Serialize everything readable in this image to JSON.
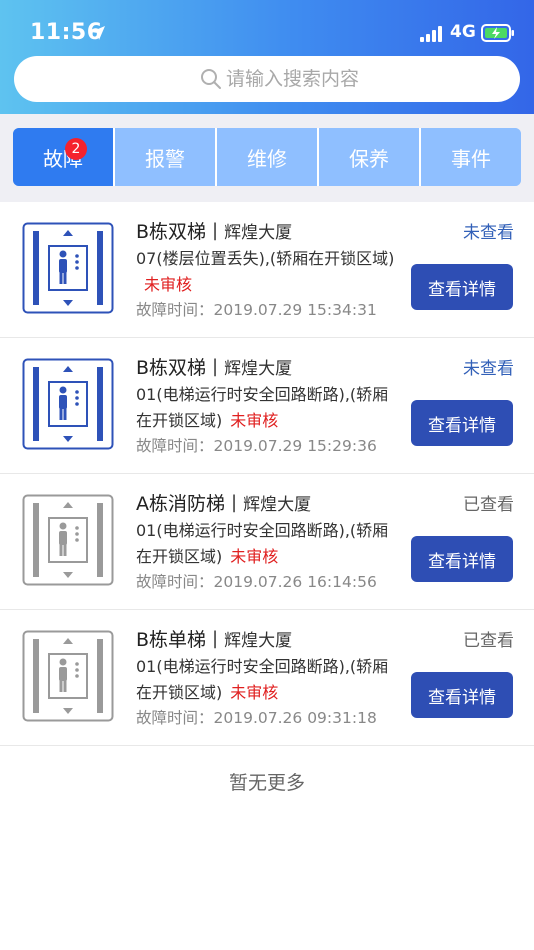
{
  "status_bar": {
    "time": "11:56",
    "network": "4G"
  },
  "search": {
    "placeholder": "请输入搜索内容"
  },
  "tabs": [
    {
      "label": "故障",
      "badge": "2",
      "active": true
    },
    {
      "label": "报警"
    },
    {
      "label": "维修"
    },
    {
      "label": "保养"
    },
    {
      "label": "事件"
    }
  ],
  "items": [
    {
      "name": "B栋双梯",
      "separator": "|",
      "building": "辉煌大厦",
      "status": "未查看",
      "desc": "07(楼层位置丢失),(轿厢在开锁区域)",
      "review": "未审核",
      "time_label": "故障时间：",
      "time": "2019.07.29 15:34:31",
      "detail_label": "查看详情",
      "icon_color": "#2e52b8"
    },
    {
      "name": "B栋双梯",
      "separator": "|",
      "building": "辉煌大厦",
      "status": "未查看",
      "desc": "01(电梯运行时安全回路断路),(轿厢在开锁区域)",
      "review": "未审核",
      "time_label": "故障时间：",
      "time": "2019.07.29 15:29:36",
      "detail_label": "查看详情",
      "icon_color": "#2e52b8"
    },
    {
      "name": "A栋消防梯",
      "separator": "|",
      "building": "辉煌大厦",
      "status": "已查看",
      "desc": "01(电梯运行时安全回路断路),(轿厢在开锁区域)",
      "review": "未审核",
      "time_label": "故障时间：",
      "time": "2019.07.26 16:14:56",
      "detail_label": "查看详情",
      "icon_color": "#9a9a9a"
    },
    {
      "name": "B栋单梯",
      "separator": "|",
      "building": "辉煌大厦",
      "status": "已查看",
      "desc": "01(电梯运行时安全回路断路),(轿厢在开锁区域)",
      "review": "未审核",
      "time_label": "故障时间：",
      "time": "2019.07.26 09:31:18",
      "detail_label": "查看详情",
      "icon_color": "#9a9a9a"
    }
  ],
  "footer": {
    "no_more": "暂无更多"
  },
  "colors": {
    "accent": "#2f7bf0",
    "button": "#2e4eb4",
    "unreviewed": "#e02020",
    "unseen": "#3260b8"
  }
}
